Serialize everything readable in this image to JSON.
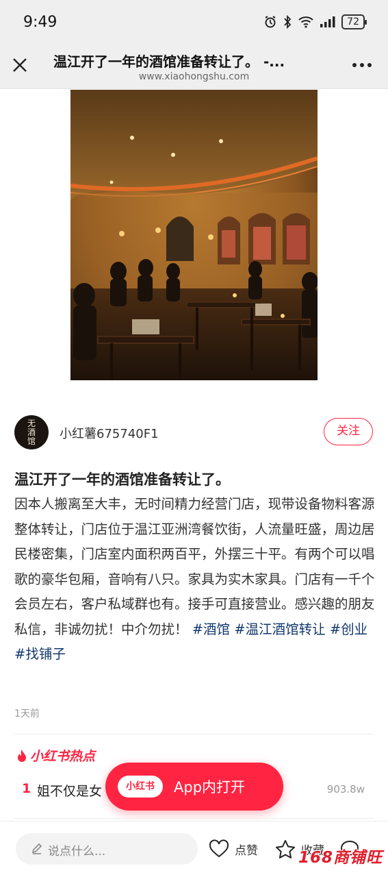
{
  "status_bar": {
    "time": "9:49",
    "battery": "72"
  },
  "browser": {
    "title": "温江开了一年的酒馆准备转让了。 -...",
    "url": "www.xiaohongshu.com"
  },
  "author": {
    "avatar_text": [
      "无",
      "酒",
      "馆"
    ],
    "name": "小红薯675740F1",
    "follow_label": "关注"
  },
  "note": {
    "title": "温江开了一年的酒馆准备转让了。",
    "body": "因本人搬离至大丰，无时间精力经营门店，现带设备物料客源整体转让，门店位于温江亚洲湾餐饮街，人流量旺盛，周边居民楼密集，门店室内面积两百平，外摆三十平。有两个可以唱歌的豪华包厢，音响有八只。家具为实木家具。门店有一千个会员左右，客户私域群也有。接手可直接营业。感兴趣的朋友私信，非诚勿扰！中介勿扰！",
    "tags": [
      "#酒馆",
      "#温江酒馆转让",
      "#创业",
      "#找铺子"
    ],
    "time": "1天前"
  },
  "hot": {
    "label": "小红书热点",
    "items": [
      {
        "rank": "1",
        "text": "姐不仅是女",
        "count": "903.8w"
      }
    ]
  },
  "open_app": {
    "logo": "小红书",
    "label": "App内打开"
  },
  "bottom": {
    "comment_placeholder": "说点什么...",
    "like_label": "点赞",
    "collect_label": "收藏"
  },
  "watermark": "168商铺旺",
  "colors": {
    "accent": "#ff2442",
    "tag": "#13386c"
  }
}
